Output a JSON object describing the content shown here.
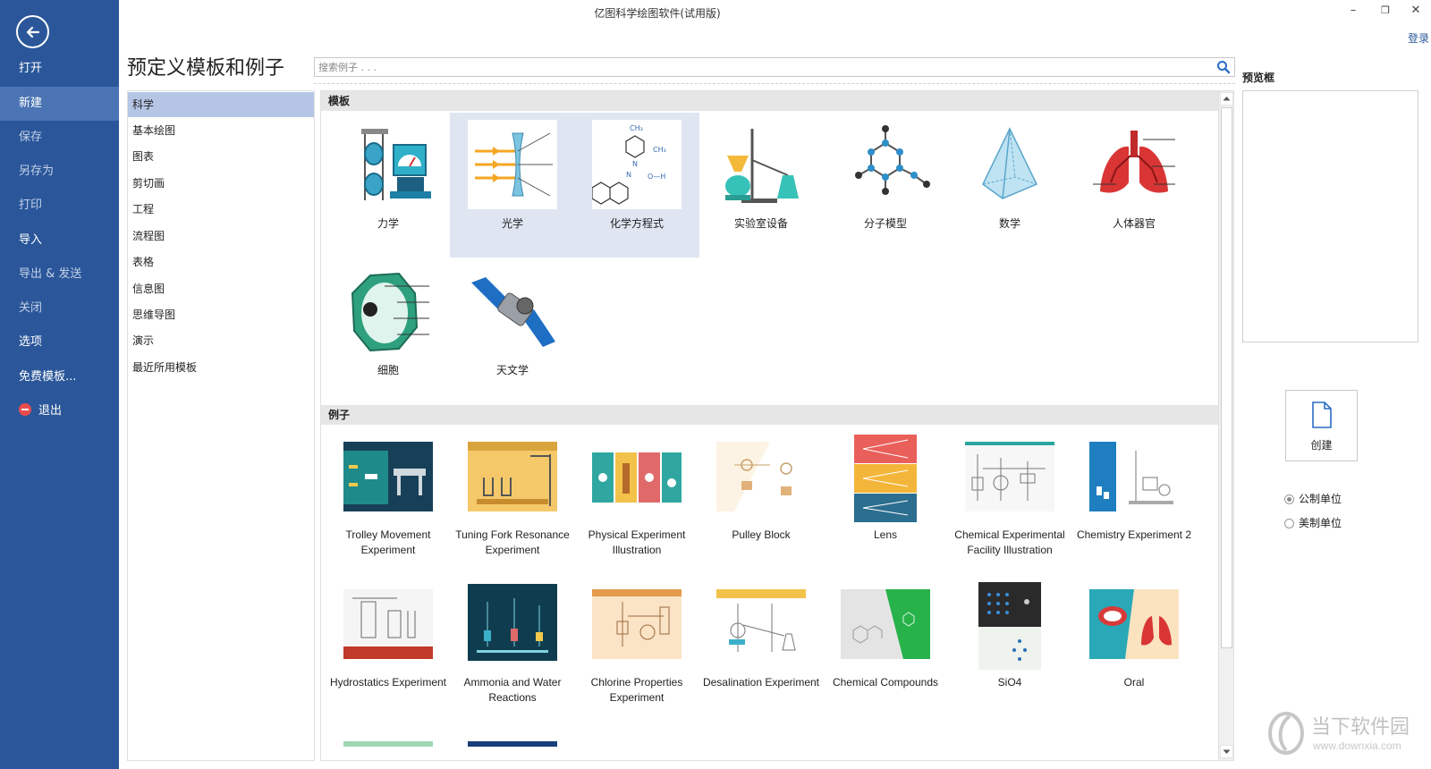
{
  "window": {
    "title": "亿图科学绘图软件(试用版)",
    "login": "登录",
    "minimize": "–",
    "restore": "❐",
    "close": "✕"
  },
  "nav": {
    "items": [
      {
        "label": "打开"
      },
      {
        "label": "新建"
      },
      {
        "label": "保存"
      },
      {
        "label": "另存为"
      },
      {
        "label": "打印"
      },
      {
        "label": "导入"
      },
      {
        "label": "导出 & 发送"
      },
      {
        "label": "关闭"
      },
      {
        "label": "选项"
      },
      {
        "label": "免费模板..."
      },
      {
        "label": "退出"
      }
    ],
    "active": "新建"
  },
  "main": {
    "heading": "预定义模板和例子",
    "search_placeholder": "搜索例子 . . ."
  },
  "categories": {
    "items": [
      {
        "label": "科学"
      },
      {
        "label": "基本绘图"
      },
      {
        "label": "图表"
      },
      {
        "label": "剪切画"
      },
      {
        "label": "工程"
      },
      {
        "label": "流程图"
      },
      {
        "label": "表格"
      },
      {
        "label": "信息图"
      },
      {
        "label": "思维导图"
      },
      {
        "label": "演示"
      },
      {
        "label": "最近所用模板"
      }
    ],
    "selected": "科学"
  },
  "templates": {
    "header": "模板",
    "items": [
      {
        "label": "力学",
        "icon": "mechanics-icon"
      },
      {
        "label": "光学",
        "icon": "optics-icon"
      },
      {
        "label": "化学方程式",
        "icon": "chemical-equation-icon",
        "formula_labels": [
          "CH₃",
          "CH₃",
          "N",
          "N",
          "O—H"
        ]
      },
      {
        "label": "实验室设备",
        "icon": "lab-equipment-icon"
      },
      {
        "label": "分子模型",
        "icon": "molecule-model-icon"
      },
      {
        "label": "数学",
        "icon": "math-pyramid-icon"
      },
      {
        "label": "人体器官",
        "icon": "lungs-icon"
      },
      {
        "label": "细胞",
        "icon": "cell-icon"
      },
      {
        "label": "天文学",
        "icon": "satellite-icon"
      }
    ],
    "selected": [
      "光学",
      "化学方程式"
    ]
  },
  "examples": {
    "header": "例子",
    "items": [
      {
        "label": "Trolley Movement Experiment"
      },
      {
        "label": "Tuning Fork Resonance Experiment"
      },
      {
        "label": "Physical Experiment Illustration"
      },
      {
        "label": "Pulley Block"
      },
      {
        "label": "Lens"
      },
      {
        "label": "Chemical Experimental Facility Illustration"
      },
      {
        "label": "Chemistry Experiment 2"
      },
      {
        "label": "Hydrostatics Experiment"
      },
      {
        "label": "Ammonia and Water Reactions"
      },
      {
        "label": "Chlorine Properties Experiment"
      },
      {
        "label": "Desalination Experiment"
      },
      {
        "label": "Chemical Compounds"
      },
      {
        "label": "SiO4"
      },
      {
        "label": "Oral"
      }
    ]
  },
  "preview": {
    "label": "预览框",
    "create_label": "创建",
    "units": [
      {
        "label": "公制单位",
        "checked": true
      },
      {
        "label": "美制单位",
        "checked": false
      }
    ]
  },
  "watermark": {
    "brand": "当下软件园",
    "url": "www.downxia.com"
  },
  "colors": {
    "nav_bg": "#2b579a",
    "nav_active": "#4a74b3",
    "category_selected": "#b5c5e6",
    "tile_selected": "#dfe6f2",
    "link": "#2b579a"
  }
}
